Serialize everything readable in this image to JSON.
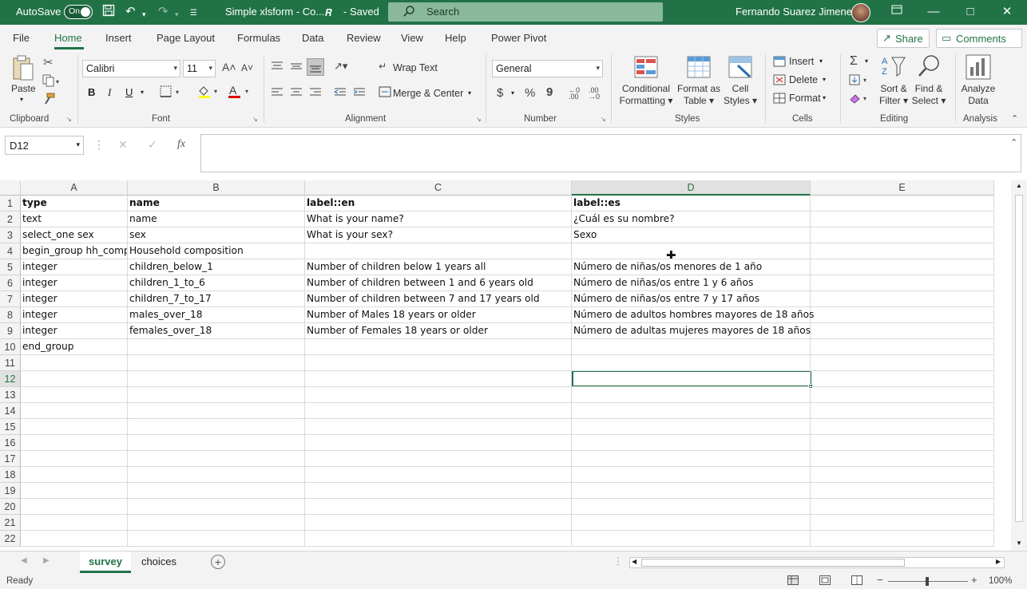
{
  "titlebar": {
    "autosave_label": "AutoSave",
    "toggle_state": "On",
    "filename": "Simple xlsform - Co...",
    "saved_status": "- Saved",
    "search_placeholder": "Search",
    "user_name": "Fernando Suarez Jimenez"
  },
  "ribbon_tabs": [
    "File",
    "Home",
    "Insert",
    "Page Layout",
    "Formulas",
    "Data",
    "Review",
    "View",
    "Help",
    "Power Pivot"
  ],
  "share_label": "Share",
  "comments_label": "Comments",
  "ribbon": {
    "clipboard": {
      "paste": "Paste",
      "label": "Clipboard"
    },
    "font": {
      "name": "Calibri",
      "size": "11",
      "label": "Font",
      "bold": "B",
      "italic": "I",
      "underline": "U"
    },
    "alignment": {
      "wrap": "Wrap Text",
      "merge": "Merge & Center",
      "label": "Alignment"
    },
    "number": {
      "format": "General",
      "label": "Number",
      "currency": "$",
      "percent": "%",
      "comma": "9"
    },
    "styles": {
      "conditional": "Conditional",
      "conditional2": "Formatting",
      "format_table": "Format as",
      "format_table2": "Table",
      "cell_styles": "Cell",
      "cell_styles2": "Styles",
      "label": "Styles"
    },
    "cells": {
      "insert": "Insert",
      "delete": "Delete",
      "format": "Format",
      "label": "Cells"
    },
    "editing": {
      "sort": "Sort &",
      "sort2": "Filter",
      "find": "Find &",
      "find2": "Select",
      "label": "Editing"
    },
    "analysis": {
      "analyze": "Analyze",
      "analyze2": "Data",
      "label": "Analysis"
    }
  },
  "formula_bar": {
    "name_box": "D12",
    "fx": "fx",
    "formula": ""
  },
  "columns": [
    "A",
    "B",
    "C",
    "D",
    "E"
  ],
  "rows": [
    [
      "type",
      "name",
      "label::en",
      "label::es",
      ""
    ],
    [
      "text",
      "name",
      "What is your name?",
      "¿Cuál es su nombre?",
      ""
    ],
    [
      "select_one sex",
      "sex",
      "What is your sex?",
      "Sexo",
      ""
    ],
    [
      "begin_group hh_comp",
      "Household composition",
      "",
      "",
      ""
    ],
    [
      "integer",
      "children_below_1",
      "Number of children below 1 years all",
      "Número de niñas/os menores de 1 año",
      ""
    ],
    [
      "integer",
      "children_1_to_6",
      "Number of children between 1 and 6 years old",
      "Número de niñas/os entre 1 y 6 años",
      ""
    ],
    [
      "integer",
      "children_7_to_17",
      "Number of children between 7 and 17 years old",
      "Número de niñas/os entre 7 y 17 años",
      ""
    ],
    [
      "integer",
      "males_over_18",
      "Number of Males 18 years or older",
      "Número de adultos hombres mayores de 18 años",
      ""
    ],
    [
      "integer",
      "females_over_18",
      "Number of Females 18 years or older",
      "Número de adultas mujeres mayores de 18 años",
      ""
    ],
    [
      "end_group",
      "",
      "",
      "",
      ""
    ]
  ],
  "row_numbers": [
    "1",
    "2",
    "3",
    "4",
    "5",
    "6",
    "7",
    "8",
    "9",
    "10",
    "11",
    "12",
    "13",
    "14",
    "15",
    "16",
    "17",
    "18",
    "19",
    "20",
    "21",
    "22"
  ],
  "selected_cell": "D12",
  "sheets": [
    "survey",
    "choices"
  ],
  "active_sheet": "survey",
  "status": {
    "ready": "Ready",
    "zoom": "100%"
  },
  "colors": {
    "accent": "#217346"
  }
}
